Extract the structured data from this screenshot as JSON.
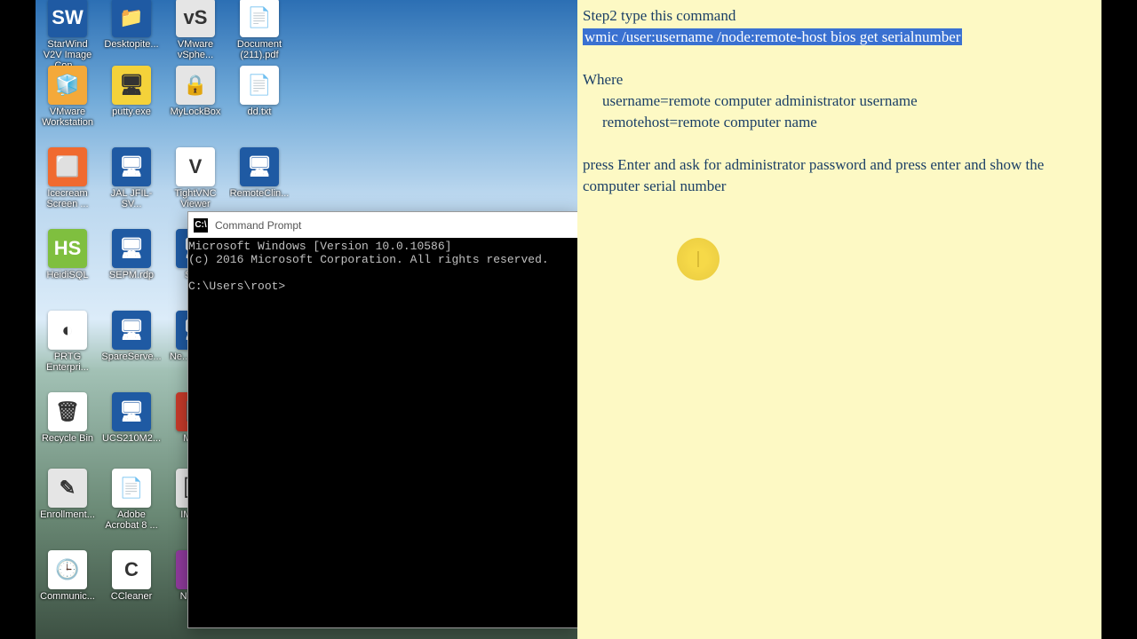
{
  "desktop": {
    "icons": [
      {
        "row": 0,
        "col": 0,
        "label": "StarWind V2V Image Con...",
        "bg": "#1f5aa3",
        "glyph": "SW"
      },
      {
        "row": 0,
        "col": 1,
        "label": "Desktopite...",
        "bg": "#1f5aa3",
        "glyph": "📁"
      },
      {
        "row": 0,
        "col": 2,
        "label": "VMware vSphe...",
        "bg": "#e5e5e5",
        "glyph": "vS"
      },
      {
        "row": 0,
        "col": 3,
        "label": "Document (211).pdf",
        "bg": "#ffffff",
        "glyph": "📄"
      },
      {
        "row": 1,
        "col": 0,
        "label": "VMware Workstation",
        "bg": "#f4a93a",
        "glyph": "🧊"
      },
      {
        "row": 1,
        "col": 1,
        "label": "putty.exe",
        "bg": "#f4d23a",
        "glyph": "🖥"
      },
      {
        "row": 1,
        "col": 2,
        "label": "MyLockBox",
        "bg": "#e5e5e5",
        "glyph": "🔒"
      },
      {
        "row": 1,
        "col": 3,
        "label": "dd.txt",
        "bg": "#ffffff",
        "glyph": "📄"
      },
      {
        "row": 2,
        "col": 0,
        "label": "Icecream Screen ...",
        "bg": "#f06a2f",
        "glyph": "⬜"
      },
      {
        "row": 2,
        "col": 1,
        "label": "JAL JFIL-SV...",
        "bg": "#1f5aa3",
        "glyph": "🖥"
      },
      {
        "row": 2,
        "col": 2,
        "label": "TightVNC Viewer",
        "bg": "#ffffff",
        "glyph": "V"
      },
      {
        "row": 2,
        "col": 3,
        "label": "RemoteClin...",
        "bg": "#1f5aa3",
        "glyph": "🖥"
      },
      {
        "row": 3,
        "col": 0,
        "label": "HeidiSQL",
        "bg": "#7fbf3f",
        "glyph": "HS"
      },
      {
        "row": 3,
        "col": 1,
        "label": "SEPM.rdp",
        "bg": "#1f5aa3",
        "glyph": "🖥"
      },
      {
        "row": 3,
        "col": 2,
        "label": "SA...",
        "bg": "#1f5aa3",
        "glyph": "🖥"
      },
      {
        "row": 4,
        "col": 0,
        "label": "PRTG Enterpri...",
        "bg": "#ffffff",
        "glyph": "◐"
      },
      {
        "row": 4,
        "col": 1,
        "label": "SpareServe...",
        "bg": "#1f5aa3",
        "glyph": "🖥"
      },
      {
        "row": 4,
        "col": 2,
        "label": "Ne... OnC...",
        "bg": "#1f5aa3",
        "glyph": "🖥"
      },
      {
        "row": 5,
        "col": 0,
        "label": "Recycle Bin",
        "bg": "#ffffff",
        "glyph": "🗑"
      },
      {
        "row": 5,
        "col": 1,
        "label": "UCS210M2...",
        "bg": "#1f5aa3",
        "glyph": "🖥"
      },
      {
        "row": 5,
        "col": 2,
        "label": "MM...",
        "bg": "#c63a2a",
        "glyph": "📕"
      },
      {
        "row": 6,
        "col": 0,
        "label": "Enrollment...",
        "bg": "#e5e5e5",
        "glyph": "✎"
      },
      {
        "row": 6,
        "col": 1,
        "label": "Adobe Acrobat 8 ...",
        "bg": "#ffffff",
        "glyph": "📄"
      },
      {
        "row": 6,
        "col": 2,
        "label": "IMG-...",
        "bg": "#e5e5e5",
        "glyph": "🖼"
      },
      {
        "row": 7,
        "col": 0,
        "label": "Communic...",
        "bg": "#ffffff",
        "glyph": "🕒"
      },
      {
        "row": 7,
        "col": 1,
        "label": "CCleaner",
        "bg": "#ffffff",
        "glyph": "C"
      },
      {
        "row": 7,
        "col": 2,
        "label": "Notel...",
        "bg": "#8f3a9c",
        "glyph": "N"
      }
    ]
  },
  "cmd": {
    "title": "Command Prompt",
    "lines": [
      "Microsoft Windows [Version 10.0.10586]",
      "(c) 2016 Microsoft Corporation. All rights reserved.",
      "",
      "C:\\Users\\root>"
    ]
  },
  "note": {
    "l1": "Step2 type this command",
    "l2": "wmic /user:username /node:remote-host bios get serialnumber",
    "l3": "Where",
    "l4": "username=remote computer administrator username",
    "l5": "remotehost=remote computer name",
    "l6": "press Enter and ask for administrator password and press enter and show the computer serial number"
  }
}
